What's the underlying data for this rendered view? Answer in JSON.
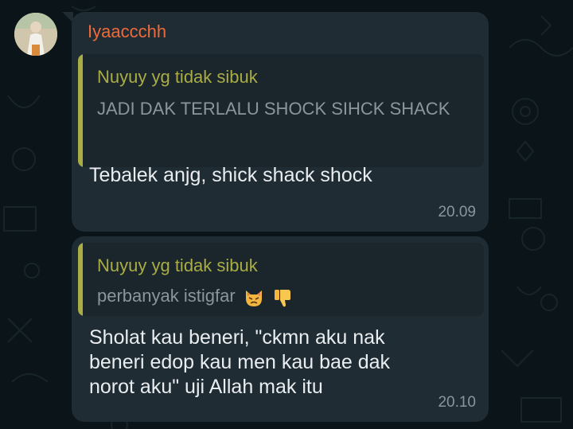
{
  "messages": [
    {
      "sender": "Iyaaccchh",
      "reply_to": {
        "author": "Nuyuy yg tidak sibuk",
        "text": "JADI DAK TERLALU SHOCK SIHCK SHACK"
      },
      "text": "Tebalek anjg, shick shack shock",
      "time": "20.09"
    },
    {
      "reply_to": {
        "author": "Nuyuy yg tidak sibuk",
        "text": "perbanyak istigfar",
        "emojis": [
          "pouting-cat-emoji",
          "thumbs-down-emoji"
        ]
      },
      "text": "Sholat kau beneri, \"ckmn aku nak beneri edop kau men kau bae dak norot aku\" uji Allah mak itu",
      "time": "20.10"
    }
  ],
  "colors": {
    "background": "#0b1418",
    "bubble": "#1f2c34",
    "quote_bg": "#1b252c",
    "quote_accent": "#a9ad44",
    "sender_name": "#ef6a3a",
    "message_text": "#e9edef",
    "meta_text": "#8b969c"
  }
}
